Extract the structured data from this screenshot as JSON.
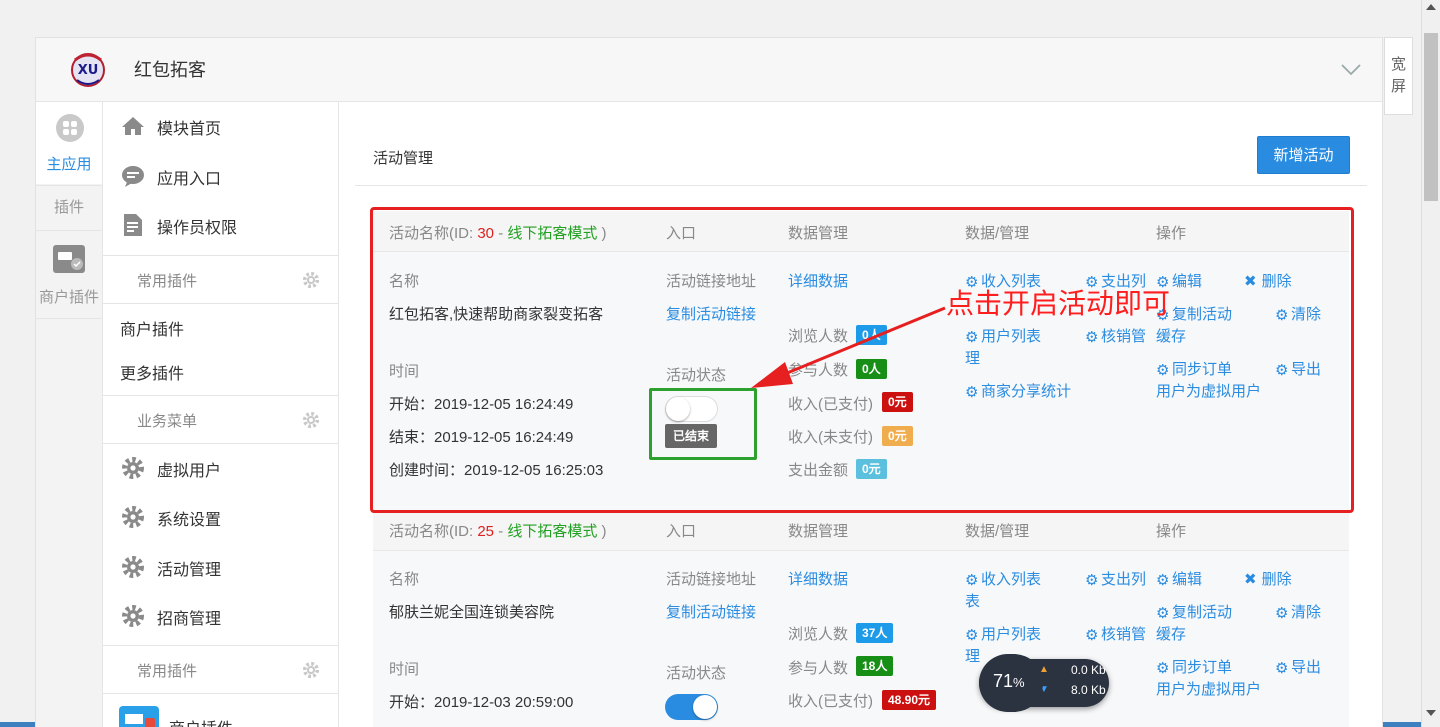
{
  "app": {
    "title": "红包拓客",
    "wide_screen": [
      "宽",
      "屏"
    ]
  },
  "rail": {
    "main": "主应用",
    "plugins": "插件",
    "merchant": "商户插件"
  },
  "sidemenu": {
    "items_top": [
      {
        "label": "模块首页",
        "icon": "home-icon"
      },
      {
        "label": "应用入口",
        "icon": "chat-bubble-icon"
      },
      {
        "label": "操作员权限",
        "icon": "document-icon"
      }
    ],
    "group_common": "常用插件",
    "plain_items": [
      "商户插件",
      "更多插件"
    ],
    "group_business": "业务菜单",
    "items_business": [
      {
        "label": "虚拟用户",
        "icon": "gear-icon"
      },
      {
        "label": "系统设置",
        "icon": "gear-icon"
      },
      {
        "label": "活动管理",
        "icon": "gear-icon"
      },
      {
        "label": "招商管理",
        "icon": "gear-icon"
      }
    ],
    "group_common2": "常用插件",
    "merchant_plugin_cut": "商户插件"
  },
  "page": {
    "heading": "活动管理",
    "new_button": "新增活动"
  },
  "columns": {
    "entry": "入口",
    "data_mgmt": "数据管理",
    "data_admin": "数据/管理",
    "ops": "操作"
  },
  "labels": {
    "name_prefix": "活动名称(ID: ",
    "dash": " - ",
    "mode": "线下拓客模式",
    "paren_close": " )",
    "name": "名称",
    "link_addr": "活动链接地址",
    "copy_link": "复制活动链接",
    "detail_data": "详细数据",
    "time": "时间",
    "status": "活动状态",
    "start_prefix": "开始：",
    "end_prefix": "结束：",
    "created_prefix": "创建时间：",
    "views": "浏览人数",
    "participants": "参与人数",
    "income_paid": "收入(已支付)",
    "income_unpaid": "收入(未支付)",
    "payout": "支出金额",
    "ended": "已结束"
  },
  "actions": {
    "income_list": "收入列表",
    "payout_list_cut": "支出列",
    "payout_list_wrap": "表",
    "user_list": "用户列表",
    "user_list_wrap": "理",
    "redeem_mgmt": "核销管",
    "merchant_share": "商家分享统计",
    "edit": "编辑",
    "delete": "删除",
    "copy_activity": "复制活动",
    "cache_wrap": "缓存",
    "clear": "清除",
    "sync_orders": "同步订单",
    "sync_wrap": "用户为虚拟用户",
    "export": "导出"
  },
  "activities": [
    {
      "id": "30",
      "title": "红包拓客,快速帮助商家裂变拓客",
      "start": "2019-12-05 16:24:49",
      "end": "2019-12-05 16:24:49",
      "created": "2019-12-05 16:25:03",
      "views": "0人",
      "participants": "0人",
      "income_paid": "0元",
      "income_unpaid": "0元",
      "payout": "0元",
      "enabled": false
    },
    {
      "id": "25",
      "title": "郁肤兰妮全国连锁美容院",
      "start": "2019-12-03 20:59:00",
      "views": "37人",
      "participants": "18人",
      "income_paid": "48.90元",
      "enabled": true
    }
  ],
  "annotation": {
    "text": "点击开启活动即可"
  },
  "net_widget": {
    "cpu": "71",
    "cpu_unit": "%",
    "up": "0.0 Kb",
    "down": "8.0 Kb"
  },
  "colors": {
    "accent": "#2a8ce0",
    "annotation_red": "#e62020",
    "annotation_green": "#2ea02e"
  }
}
